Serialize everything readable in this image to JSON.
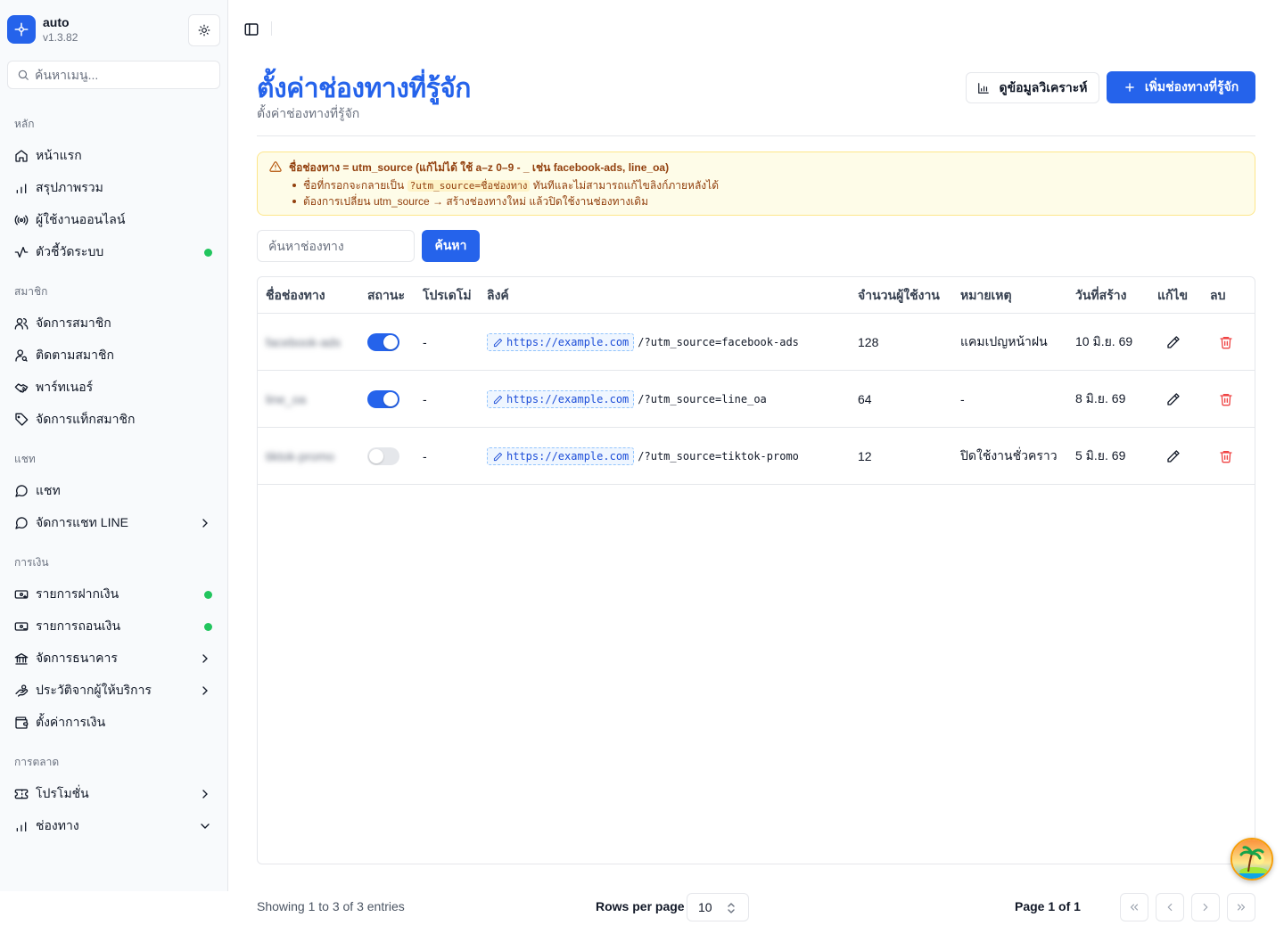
{
  "sidebar": {
    "brand_name": "auto",
    "brand_version": "v1.3.82",
    "search_placeholder": "ค้นหาเมนู...",
    "groups": [
      {
        "label": "หลัก",
        "items": [
          {
            "label": "หน้าแรก",
            "icon": "home-icon"
          },
          {
            "label": "สรุปภาพรวม",
            "icon": "bar-chart-icon"
          },
          {
            "label": "ผู้ใช้งานออนไลน์",
            "icon": "radio-icon"
          },
          {
            "label": "ตัวชี้วัดระบบ",
            "icon": "activity-icon",
            "status_dot": "#22c55e"
          }
        ]
      },
      {
        "label": "สมาชิก",
        "items": [
          {
            "label": "จัดการสมาชิก",
            "icon": "users-icon"
          },
          {
            "label": "ติดตามสมาชิก",
            "icon": "user-search-icon"
          },
          {
            "label": "พาร์ทเนอร์",
            "icon": "handshake-icon"
          },
          {
            "label": "จัดการแท็กสมาชิก",
            "icon": "tag-icon"
          }
        ]
      },
      {
        "label": "แชท",
        "items": [
          {
            "label": "แชท",
            "icon": "message-circle-icon"
          },
          {
            "label": "จัดการแชท LINE",
            "icon": "message-circle-icon",
            "chevron": "right"
          }
        ]
      },
      {
        "label": "การเงิน",
        "items": [
          {
            "label": "รายการฝากเงิน",
            "icon": "banknote-in-icon",
            "status_dot": "#22c55e"
          },
          {
            "label": "รายการถอนเงิน",
            "icon": "banknote-out-icon",
            "status_dot": "#22c55e"
          },
          {
            "label": "จัดการธนาคาร",
            "icon": "bank-icon",
            "chevron": "right"
          },
          {
            "label": "ประวัติจากผู้ให้บริการ",
            "icon": "hand-coins-icon",
            "chevron": "right"
          },
          {
            "label": "ตั้งค่าการเงิน",
            "icon": "wallet-icon"
          }
        ]
      },
      {
        "label": "การตลาด",
        "items": [
          {
            "label": "โปรโมชั่น",
            "icon": "ticket-icon",
            "chevron": "right"
          },
          {
            "label": "ช่องทาง",
            "icon": "bar-chart-icon",
            "chevron": "down"
          }
        ]
      }
    ]
  },
  "header": {
    "title": "ตั้งค่าช่องทางที่รู้จัก",
    "subtitle": "ตั้งค่าช่องทางที่รู้จัก",
    "analytics_button": "ดูข้อมูลวิเคราะห์",
    "add_button": "เพิ่มช่องทางที่รู้จัก"
  },
  "alert": {
    "title": "ชื่อช่องทาง = utm_source (แก้ไม่ได้ ใช้ a–z 0–9 - _ เช่น facebook-ads, line_oa)",
    "line1_pre": "ชื่อที่กรอกจะกลายเป็น",
    "line1_code": "?utm_source=ชื่อช่องทาง",
    "line1_post": "ทันทีและไม่สามารถแก้ไขลิงก์ภายหลังได้",
    "line2": "ต้องการเปลี่ยน utm_source → สร้างช่องทางใหม่ แล้วปิดใช้งานช่องทางเดิม"
  },
  "search": {
    "placeholder": "ค้นหาช่องทาง",
    "button": "ค้นหา"
  },
  "table": {
    "columns": [
      "ชื่อช่องทาง",
      "สถานะ",
      "โปรเดโม่",
      "ลิงค์",
      "จำนวนผู้ใช้งาน",
      "หมายเหตุ",
      "วันที่สร้าง",
      "แก้ไข",
      "ลบ"
    ],
    "rows": [
      {
        "name": "facebook-ads",
        "active": true,
        "promo": "-",
        "base_url": "https://example.com",
        "path": "/?utm_source=facebook-ads",
        "users": "128",
        "note": "แคมเปญหน้าฝน",
        "created": "10 มิ.ย. 69"
      },
      {
        "name": "line_oa",
        "active": true,
        "promo": "-",
        "base_url": "https://example.com",
        "path": "/?utm_source=line_oa",
        "users": "64",
        "note": "-",
        "created": "8 มิ.ย. 69"
      },
      {
        "name": "tiktok-promo",
        "active": false,
        "promo": "-",
        "base_url": "https://example.com",
        "path": "/?utm_source=tiktok-promo",
        "users": "12",
        "note": "ปิดใช้งานชั่วคราว",
        "created": "5 มิ.ย. 69"
      }
    ]
  },
  "footer": {
    "showing": "Showing 1 to 3 of 3 entries",
    "rows_per_page_label": "Rows per page",
    "rows_per_page_value": "10",
    "page_info": "Page 1 of 1"
  },
  "colors": {
    "accent": "#2563eb",
    "alert_bg": "#fefce8",
    "alert_text": "#92400e",
    "danger": "#ef4444",
    "status_online": "#22c55e"
  }
}
